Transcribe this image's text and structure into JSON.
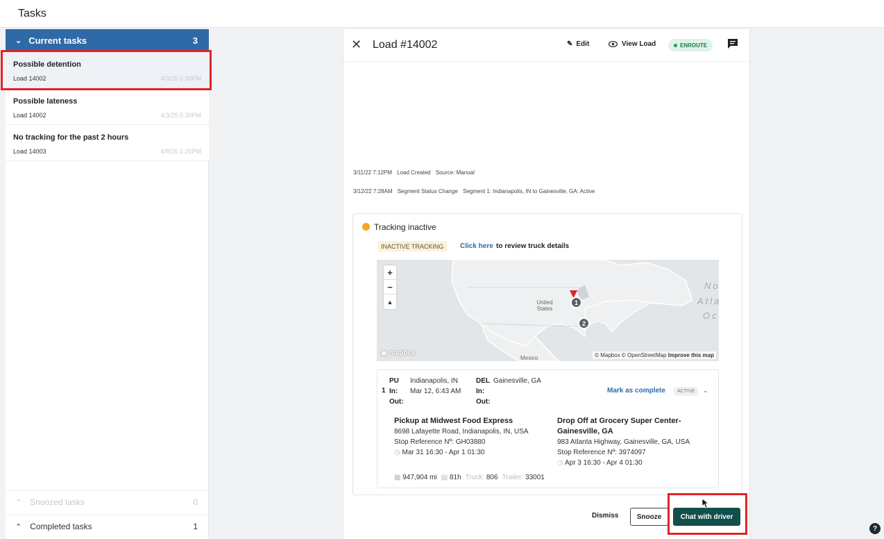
{
  "app": {
    "title": "Tasks"
  },
  "sidebar": {
    "current": {
      "label": "Current tasks",
      "count": "3"
    },
    "tasks": [
      {
        "title": "Possible detention",
        "load": "Load 14002",
        "date": "4/3/25 5:30PM"
      },
      {
        "title": "Possible lateness",
        "load": "Load 14002",
        "date": "4/3/25 5:30PM"
      },
      {
        "title": "No tracking for the past 2 hours",
        "load": "Load 14003",
        "date": "4/8/25 1:25PM"
      }
    ],
    "snoozed": {
      "label": "Snoozed tasks",
      "count": "0"
    },
    "completed": {
      "label": "Completed tasks",
      "count": "1"
    }
  },
  "panel": {
    "title": "Load #14002",
    "edit_label": "Edit",
    "view_label": "View Load",
    "status": "ENROUTE",
    "log": [
      {
        "time": "3/11/22 7:12PM",
        "event": "Load Created",
        "detail": "Source: Manual"
      },
      {
        "time": "3/12/22 7:28AM",
        "event": "Segment Status Change",
        "detail": "Segment 1: Indianapolis, IN to Gainesville, GA: Active"
      }
    ],
    "tracking": {
      "title": "Tracking inactive",
      "tag": "INACTIVE TRACKING",
      "link": "Click here",
      "link_suffix": "to review truck details"
    },
    "map": {
      "zoom_in": "+",
      "zoom_out": "−",
      "compass": "▲",
      "label_country": "United States",
      "label_mexico": "Mexico",
      "ocean_line1": "No",
      "ocean_line2": "Atla",
      "ocean_line3": "Oc",
      "logo": "mapbox",
      "attr_copy": "© Mapbox © OpenStreetMap",
      "attr_improve": "Improve this map",
      "pin1": "1",
      "pin2": "2"
    },
    "stop": {
      "num": "1",
      "pu_label": "PU",
      "pu_city": "Indianapolis, IN",
      "in_label": "In:",
      "pu_in": "Mar 12, 6:43 AM",
      "out_label": "Out:",
      "del_label": "DEL",
      "del_city": "Gainesville, GA",
      "mark_complete": "Mark as complete",
      "active": "ACTIVE",
      "pickup_name": "Pickup at Midwest Food Express",
      "pickup_addr": "8698 Lafayette Road, Indianapolis, IN, USA",
      "pickup_ref": "Stop Reference Nº: GH03880",
      "pickup_window": "Mar 31 16:30 - Apr 1 01:30",
      "drop_name_1": "Drop Off at Grocery Super Center-",
      "drop_name_2": "Gainesville, GA",
      "drop_addr": "983 Atlanta Highway, Gainesville, GA, USA",
      "drop_ref": "Stop Reference Nº: 3974097",
      "drop_window": "Apr 3 16:30 - Apr 4 01:30",
      "miles": "947,904 mi",
      "hours": "81h",
      "truck_label": "Truck:",
      "truck": "806",
      "trailer_label": "Trailer:",
      "trailer": "33001"
    },
    "actions": {
      "dismiss": "Dismiss",
      "snooze": "Snooze",
      "chat": "Chat with driver"
    }
  },
  "help": "?",
  "colors": {
    "accent": "#2f6aa8",
    "chat_button": "#124f4c",
    "highlight": "#e0242a",
    "tracking_dot": "#f5a623"
  }
}
